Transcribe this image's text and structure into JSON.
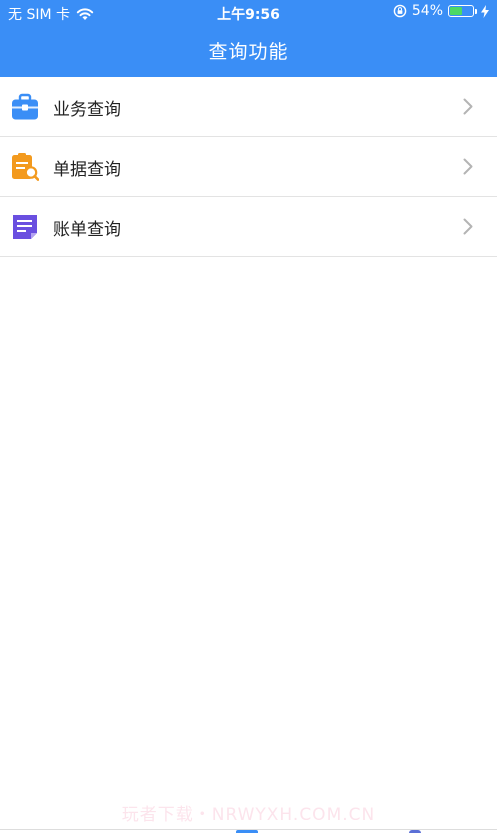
{
  "status_bar": {
    "carrier": "无 SIM 卡",
    "time": "上午9:56",
    "battery_percent_text": "54%",
    "battery_level": 0.54,
    "battery_fill_color": "#4cd964"
  },
  "nav": {
    "title": "查询功能",
    "background_color": "#3a8ef6"
  },
  "menu": {
    "items": [
      {
        "label": "业务查询",
        "icon": "briefcase-icon",
        "icon_color": "#3a8ef6"
      },
      {
        "label": "单据查询",
        "icon": "receipt-search-icon",
        "icon_color": "#f39a1e"
      },
      {
        "label": "账单查询",
        "icon": "bill-document-icon",
        "icon_color": "#6a4fe0"
      }
    ]
  },
  "watermark": {
    "text": "玩者下载・NRWYXH.COM.CN"
  }
}
